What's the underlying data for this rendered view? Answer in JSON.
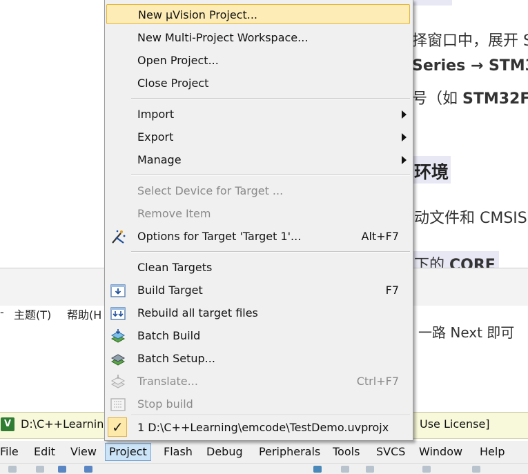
{
  "document": {
    "line1": "择窗口中，展开 S",
    "line2_pre": "Series → ",
    "line2_strong": "STM3",
    "line3_pre": "号（如 ",
    "line3_strong": "STM32F",
    "heading": "环境",
    "line5": "动文件和 CMSIS",
    "line6_pre": "下的 ",
    "line6_strong": "CORE",
    "line7": "一路 Next 即可"
  },
  "background_menu": {
    "theme": "主题(T)",
    "help": "帮助(H",
    "dash": "-"
  },
  "window": {
    "title_left": "D:\\C++Learning",
    "title_right": "Use License]"
  },
  "menubar": [
    "File",
    "Edit",
    "View",
    "Project",
    "Flash",
    "Debug",
    "Peripherals",
    "Tools",
    "SVCS",
    "Window",
    "Help"
  ],
  "project_menu": {
    "new_project": "New µVision Project...",
    "new_multi": "New Multi-Project Workspace...",
    "open_project": "Open Project...",
    "close_project": "Close Project",
    "import": "Import",
    "export": "Export",
    "manage": "Manage",
    "select_device": "Select Device for Target ...",
    "remove_item": "Remove Item",
    "options_target": "Options for Target 'Target 1'...",
    "options_shortcut": "Alt+F7",
    "clean_targets": "Clean Targets",
    "build_target": "Build Target",
    "build_shortcut": "F7",
    "rebuild_all": "Rebuild all target files",
    "batch_build": "Batch Build",
    "batch_setup": "Batch Setup...",
    "translate": "Translate...",
    "translate_shortcut": "Ctrl+F7",
    "stop_build": "Stop build",
    "recent_project": "1 D:\\C++Learning\\emcode\\TestDemo.uvprojx",
    "check_mark": "✓"
  },
  "colors": {
    "highlight_bg": "#fdecb5",
    "highlight_border": "#e5b63c",
    "menu_bg": "#f0f0f0",
    "disabled_text": "#8a8a8a",
    "titlebar_bg": "#f8f8da"
  }
}
